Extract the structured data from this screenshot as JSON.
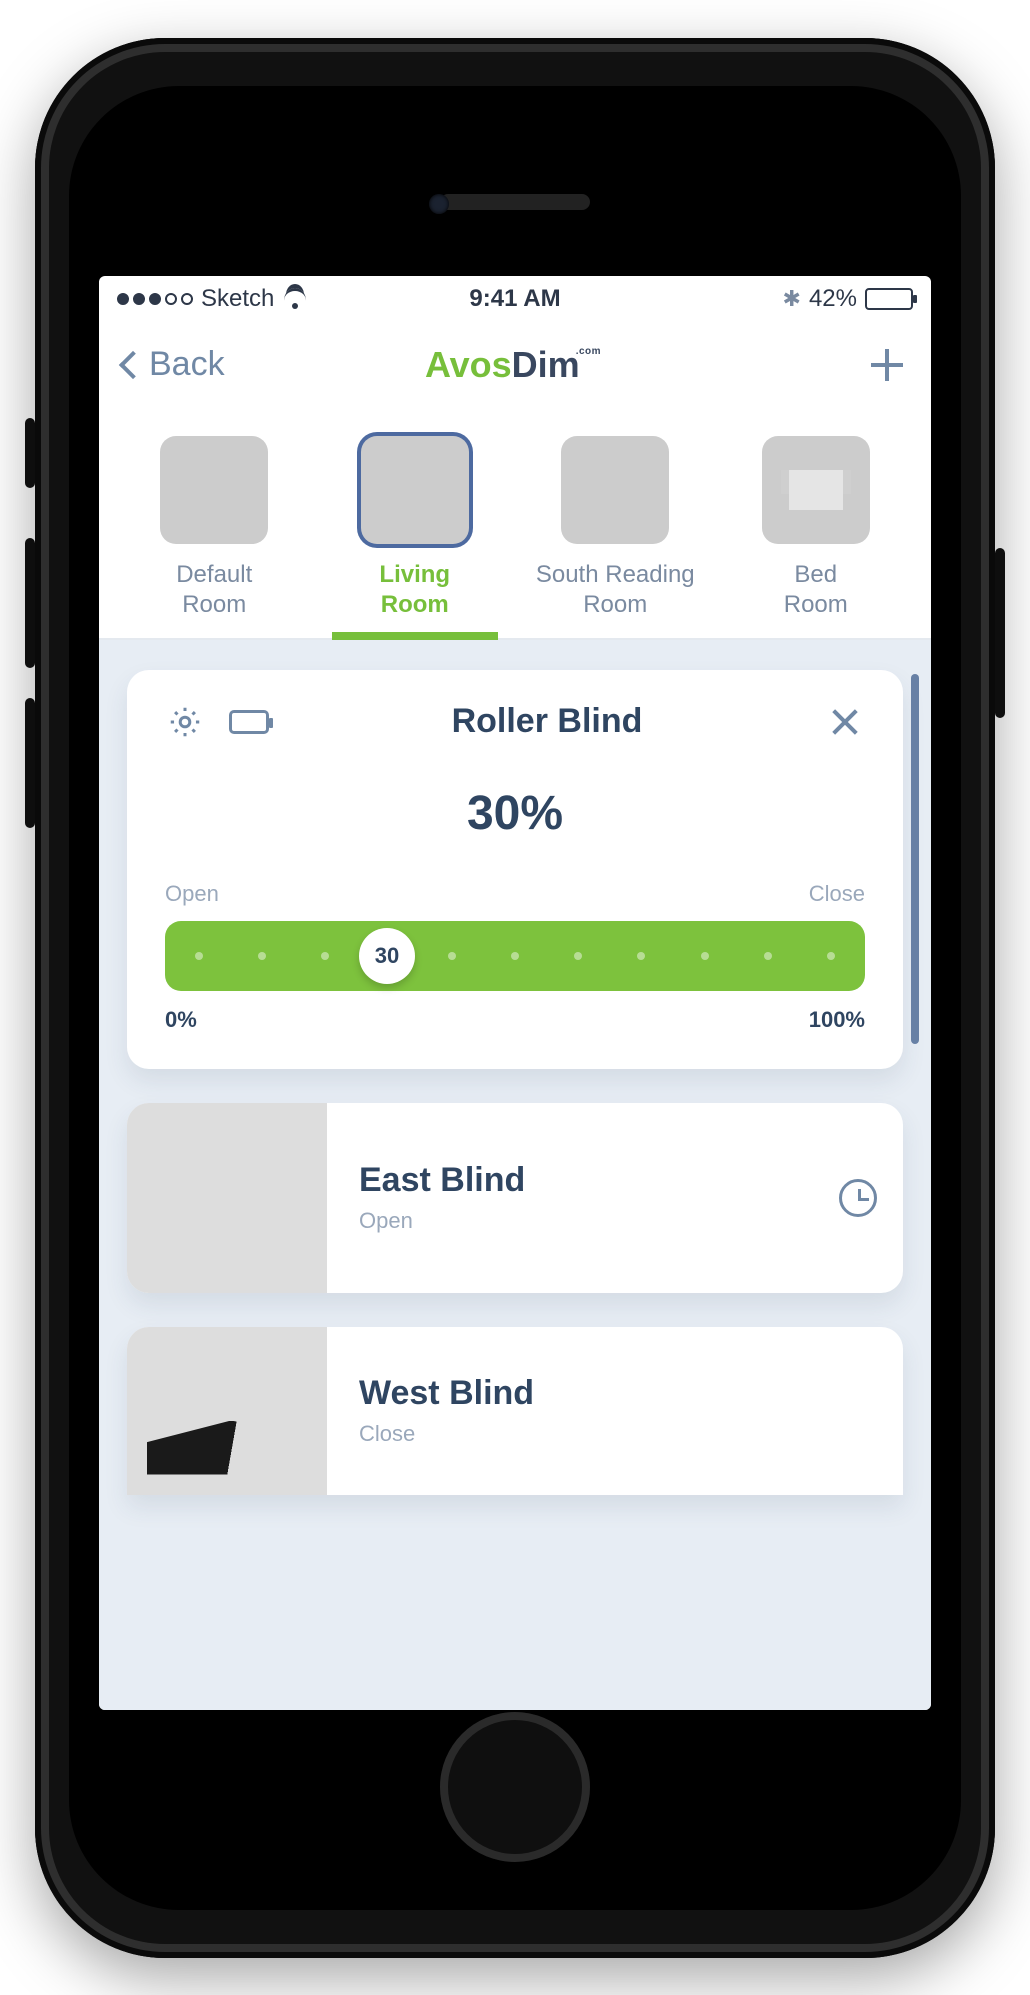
{
  "status": {
    "carrier": "Sketch",
    "time": "9:41 AM",
    "battery_pct": "42%"
  },
  "nav": {
    "back_label": "Back",
    "brand_part1": "Avos",
    "brand_part2": "Dim",
    "brand_sup": ".com"
  },
  "rooms": [
    {
      "label": "Default Room",
      "active": false
    },
    {
      "label": "Living Room",
      "active": true
    },
    {
      "label": "South Reading Room",
      "active": false
    },
    {
      "label": "Bed Room",
      "active": false
    }
  ],
  "control": {
    "title": "Roller Blind",
    "percent_display": "30%",
    "open_label": "Open",
    "close_label": "Close",
    "min_label": "0%",
    "max_label": "100%",
    "knob_value": "30",
    "knob_pos_pct": 30
  },
  "blinds": [
    {
      "name": "East Blind",
      "state": "Open",
      "has_schedule": true
    },
    {
      "name": "West Blind",
      "state": "Close",
      "has_schedule": false
    }
  ]
}
